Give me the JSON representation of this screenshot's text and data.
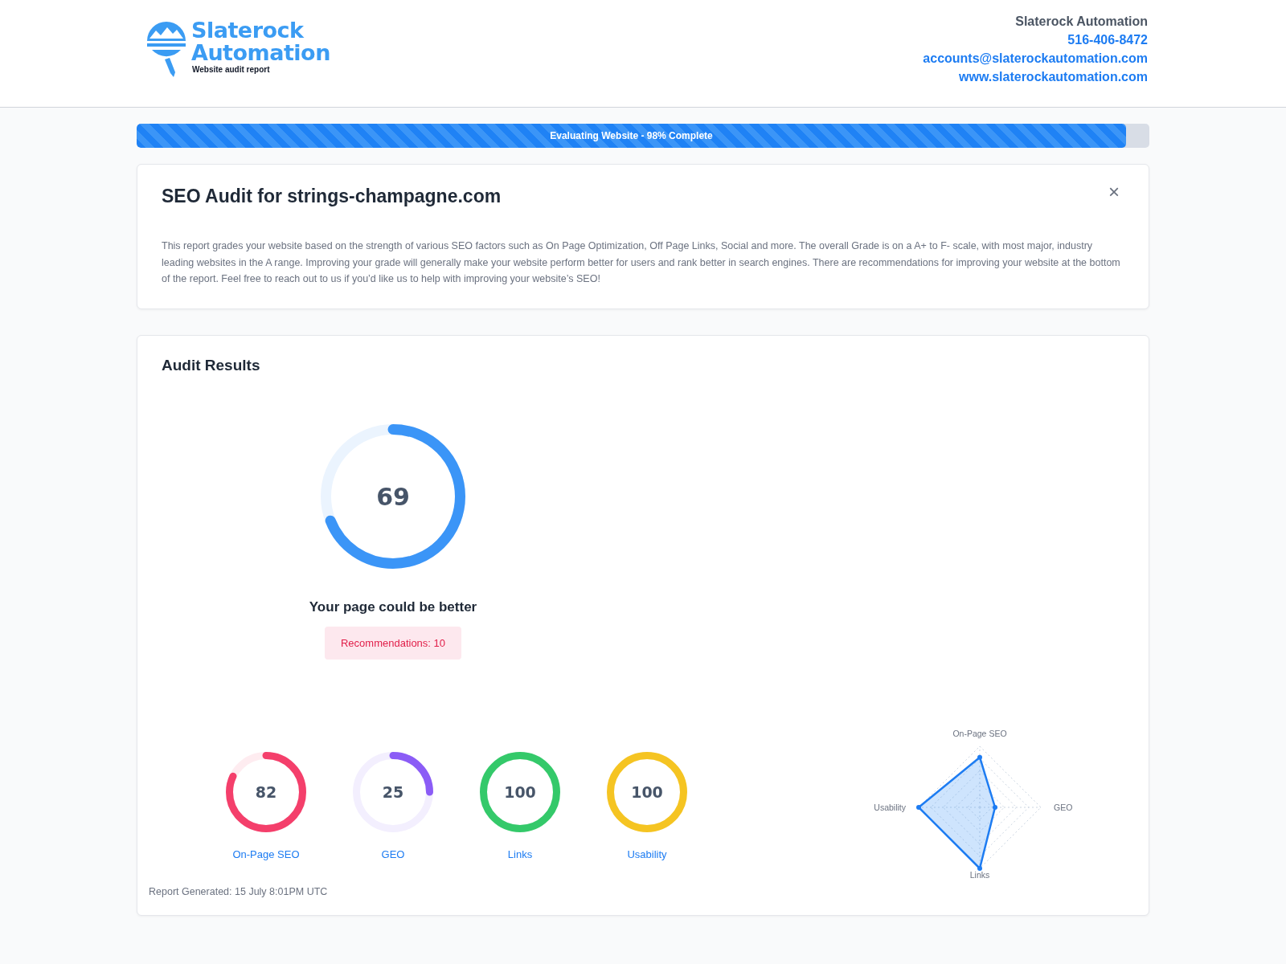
{
  "logo": {
    "line1": "Slaterock",
    "line2": "Automation",
    "tagline": "Website audit report"
  },
  "contact": {
    "company": "Slaterock Automation",
    "phone": "516-406-8472",
    "email": "accounts@slaterockautomation.com",
    "website": "www.slaterockautomation.com"
  },
  "progress": {
    "label": "Evaluating Website - 98% Complete",
    "level": 0.977
  },
  "intro": {
    "title": "SEO Audit for strings-champagne.com",
    "close": "×",
    "text": "This report grades your website based on the strength of various SEO factors such as On Page Optimization, Off Page Links, Social and more. The overall Grade is on a A+ to F- scale, with most major, industry leading websites in the A range. Improving your grade will generally make your website perform better for users and rank better in search engines. There are recommendations for improving your website at the bottom of the report. Feel free to reach out to us if you’d like us to help with improving your website’s SEO!"
  },
  "results": {
    "title": "Audit Results",
    "overall": {
      "score": "69",
      "level": 0.69,
      "verdict": "Your page could be better",
      "recommendations": "Recommendations: 10"
    },
    "scores": [
      {
        "label": "On-Page SEO",
        "score": "82",
        "level": 0.82,
        "color": "#f43f6b"
      },
      {
        "label": "GEO",
        "score": "25",
        "level": 0.25,
        "color": "#8b5cf6"
      },
      {
        "label": "Links",
        "score": "100",
        "level": 1,
        "color": "#34c96a"
      },
      {
        "label": "Usability",
        "score": "100",
        "level": 1,
        "color": "#f5c422"
      }
    ],
    "radar_labels": [
      "On-Page SEO",
      "GEO",
      "Links",
      "Usability"
    ],
    "footer": "Report Generated: 15 July 8:01PM UTC"
  }
}
